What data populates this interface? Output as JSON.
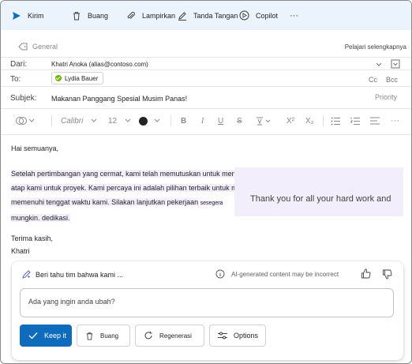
{
  "toolbar": {
    "send_label": "Kirim",
    "discard_label": "Buang",
    "attach_label": "Lampirkan",
    "signature_label": "Tanda Tangan",
    "copilot_label": "Copilot",
    "more_label": "···"
  },
  "sensitivity": {
    "label": "General",
    "learn_more": "Pelajari selengkapnya"
  },
  "from": {
    "label": "Dari:",
    "value": "Khatri  Anoka  (alias@contoso.com)"
  },
  "to": {
    "label": "To:",
    "recipient": "Lydia Bauer",
    "cc_label": "Cc",
    "bcc_label": "Bcc"
  },
  "subject": {
    "label": "Subjek:",
    "value": "Makanan Panggang Spesial Musim Panas!",
    "priority_label": "Priority"
  },
  "format": {
    "font": "Calibri",
    "size": "12",
    "bold": "B",
    "italic": "I",
    "underline": "U",
    "strike": "S",
    "superscript": "X²",
    "subscript": "X₂"
  },
  "message": {
    "greeting": "Hai semuanya,",
    "line1": "Setelah pertimbangan yang cermat, kami telah memutuskan untuk menggunakan shingle tanah liat sebagai bahan",
    "line2": "atap kami untuk proyek. Kami percaya ini adalah pilihan terbaik untuk memastikan keberhasilan proyek dan",
    "line3a": "memenuhi tenggat waktu kami. Silakan lanjutkan pekerjaan",
    "line3b": "sesegera",
    "line4": "mungkin. dedikasi.",
    "thanks_suggestion": "Thank you for all your hard work and",
    "closing": "Terima kasih,",
    "signature": "Khatri"
  },
  "copilot": {
    "title": "Beri tahu tim bahwa kami ...",
    "ai_note": "AI-generated content may be incorrect",
    "prompt_placeholder": "Ada yang ingin anda ubah?",
    "keep_label": "Keep it",
    "discard_label": "Buang",
    "regenerate_label": "Regenerasi",
    "options_label": "Options"
  },
  "colors": {
    "accent": "#0f6cbd",
    "toolbar_bg": "#ebf3fc",
    "highlight": "#f3eefc",
    "presence": "#6bb700"
  }
}
